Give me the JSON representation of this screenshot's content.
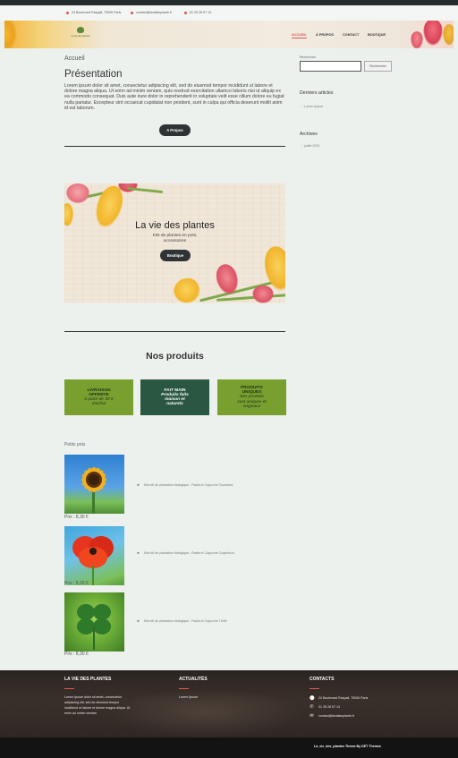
{
  "contact_bar": {
    "address": "24 Boulevard Raspail, 75006 Paris",
    "email": "contact@lavialesplante.fr",
    "phone": "01 39 28 97 13"
  },
  "header": {
    "logo_text": "La vie des plantes",
    "nav": [
      "ACCUEIL",
      "À PROPOS",
      "CONTACT",
      "BOUTIQUE"
    ]
  },
  "main": {
    "breadcrumb": "Accueil",
    "title": "Présentation",
    "intro": "Lorem ipsum dolor sit amet, consectetur adipiscing elit, sed do eiusmod tempor incididunt ut labore et dolore magna aliqua. Ut enim ad minim veniam, quis nostrud exercitation ullamco laboris nisi ut aliquip ex ea commodo consequat. Duis aute irure dolor in reprehenderit in voluptate velit esse cillum dolore eu fugiat nulla pariatur. Excepteur sint occaecat cupidatat non proident, sunt in culpa qui officia deserunt mollit anim id est laborum.",
    "about_button": "A Propos"
  },
  "hero": {
    "title": "La vie des plantes",
    "subtitle_line1": "Kits de plantes en pots,",
    "subtitle_line2": "accessoires",
    "button": "Boutique"
  },
  "products": {
    "heading": "Nos produits",
    "features": [
      {
        "title": "LIVRAISON",
        "title2": "OFFERTE",
        "desc1": "à partir de 30 €",
        "desc2": "d'achat",
        "desc3": ""
      },
      {
        "title": "FAIT MAIN",
        "title2": "",
        "desc1": "Produits faits",
        "desc2": "maison et",
        "desc3": "naturels"
      },
      {
        "title": "PRODUITS",
        "title2": "UNIQUES",
        "desc1": "Nos produits",
        "desc2": "sont uniques et",
        "desc3": "originaux"
      }
    ],
    "category": "Petits pots",
    "items": [
      {
        "price": "Prix : 8,30 €",
        "desc": "Mini kit de plantation biologique - Radis et Capucine Tournesol"
      },
      {
        "price": "Prix : 8,30 €",
        "desc": "Mini kit de plantation biologique - Radis et Capucine Coquelicot"
      },
      {
        "price": "Prix : 8,30 €",
        "desc": "Mini kit de plantation biologique - Radis et Capucine Trèfle"
      }
    ]
  },
  "sidebar": {
    "search_label": "Rechercher",
    "search_placeholder": "",
    "search_button": "Rechercher",
    "recent_title": "Derniers articles",
    "recent_items": [
      "Lorem Ipsum"
    ],
    "archives_title": "Archives",
    "archive_items": [
      "juillet 2024"
    ]
  },
  "footer": {
    "col1_title": "LA VIE DES PLANTES",
    "col1_text1": "Lorem Ipsum dolor sit amet, consectetur",
    "col1_text2": "adipiscing elit, sed do eiusmod tempor",
    "col1_text3": "incididunt ut labore et dolore magna aliqua. Ut",
    "col1_text4": "enim ad minim veniam",
    "col2_title": "ACTUALITÉS",
    "col2_link": "Lorem Ipsum",
    "col3_title": "CONTACTS",
    "address": "24 Boulevard Raspail, 75006 Paris",
    "phone": "01 39 28 97 13",
    "email": "contact@lavialesplante.fr",
    "credit": "La_vie_des_plantes Theme By DET Themes"
  },
  "colors": {
    "accent": "#e2574f",
    "green": "#79a02f",
    "dark_green": "#2a5742",
    "button_dark": "#2f3336"
  }
}
